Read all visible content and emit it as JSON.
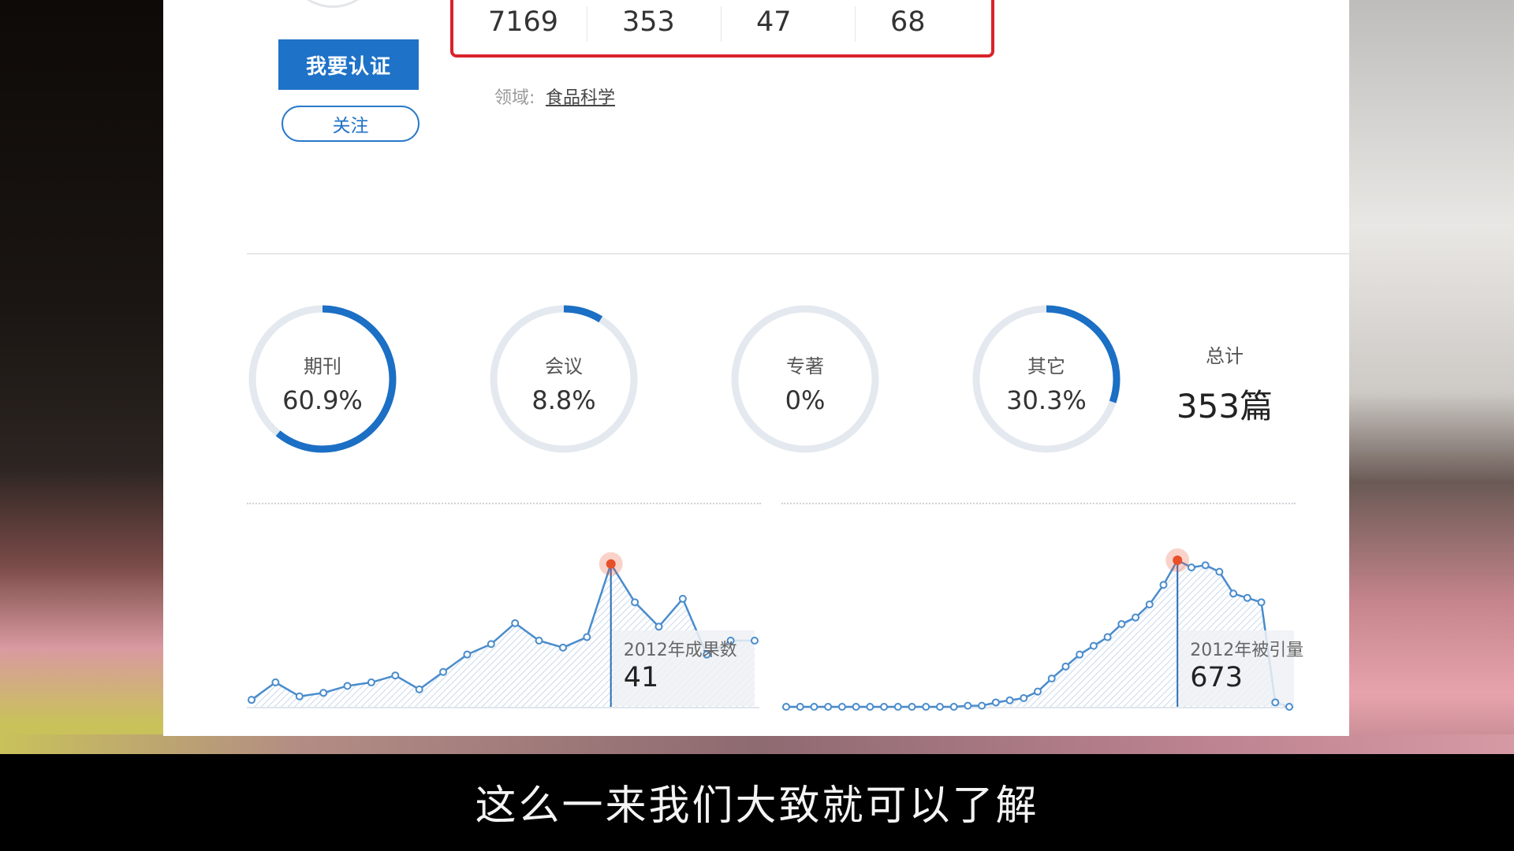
{
  "profile": {
    "verify_label": "我要认证",
    "follow_label": "关注",
    "stats": [
      "7169",
      "353",
      "47",
      "68"
    ],
    "field_label": "领域:",
    "field_value": "食品科学"
  },
  "distribution": {
    "items": [
      {
        "label": "期刊",
        "value": "60.9%",
        "percent": 60.9
      },
      {
        "label": "会议",
        "value": "8.8%",
        "percent": 8.8
      },
      {
        "label": "专著",
        "value": "0%",
        "percent": 0
      },
      {
        "label": "其它",
        "value": "30.3%",
        "percent": 30.3
      }
    ],
    "total_label": "总计",
    "total_value": "353篇",
    "ring_color": "#1b6fc4",
    "track_color": "#e4e8ef"
  },
  "charts": {
    "outputs_tooltip": {
      "year": "2012年成果数",
      "value": "41"
    },
    "citations_tooltip": {
      "year": "2012年被引量",
      "value": "673"
    },
    "line_color": "#4a8ccc",
    "highlight_color": "#e8502a"
  },
  "chart_data": [
    {
      "type": "area",
      "values": [
        2,
        7,
        3,
        4,
        6,
        7,
        9,
        5,
        10,
        15,
        18,
        24,
        19,
        17,
        20,
        41,
        30,
        23,
        31,
        15,
        19,
        19
      ],
      "highlight_index": 15,
      "ylim": [
        0,
        45
      ]
    },
    {
      "type": "area",
      "values": [
        0,
        0,
        0,
        0,
        0,
        0,
        0,
        0,
        0,
        0,
        0,
        0,
        0,
        5,
        5,
        20,
        30,
        40,
        70,
        130,
        185,
        240,
        280,
        320,
        380,
        410,
        470,
        560,
        673,
        640,
        650,
        620,
        520,
        500,
        480,
        20,
        0
      ],
      "highlight_index": 28,
      "ylim": [
        0,
        720
      ]
    }
  ],
  "subtitle": "这么一来我们大致就可以了解"
}
